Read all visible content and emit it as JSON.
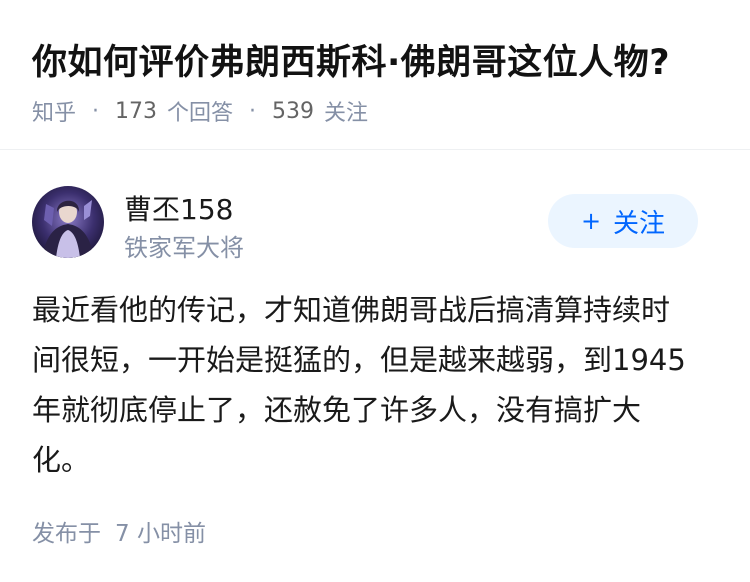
{
  "question": {
    "title": "你如何评价弗朗西斯科·佛朗哥这位人物?",
    "source": "知乎",
    "answer_count": "173",
    "answer_label": "个回答",
    "follow_count": "539",
    "follow_label": "关注"
  },
  "author": {
    "name": "曹丕158",
    "badge": "铁家军大将",
    "avatar_icon": "avatar-image",
    "follow_button_icon": "plus-icon",
    "follow_button_label": "关注"
  },
  "answer": {
    "lines": [
      "最近看他的传记，才知道佛朗哥战后搞清算持续时",
      "间很短，一开始是挺猛的，但是越来越弱，到1945",
      "年就彻底停止了，还赦免了许多人，没有搞扩大",
      "化。"
    ],
    "published_label": "发布于",
    "published_time": "7 小时前"
  },
  "colors": {
    "accent": "#0066ff",
    "button_bg": "#ebf5ff",
    "meta_gray": "#8590a6",
    "text": "#1a1a1a"
  }
}
